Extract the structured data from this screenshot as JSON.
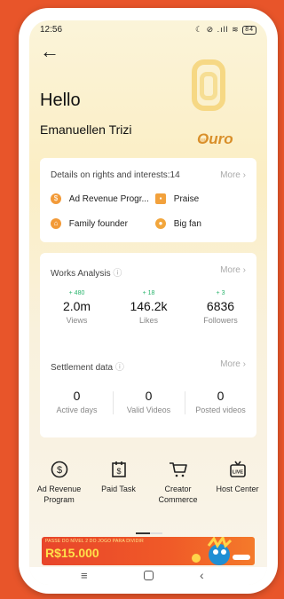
{
  "status_bar": {
    "time": "12:56",
    "icons": "☾ ⊘ .ıll ≋",
    "battery": "84"
  },
  "header": {
    "greeting": "Hello",
    "user_name": "Emanuellen Trizi",
    "level_roman": "III",
    "level_name": "Ouro"
  },
  "rights": {
    "title": "Details on rights and interests:14",
    "more": "More",
    "items": [
      {
        "label": "Ad Revenue Progr...",
        "icon": "dollar-coin-icon",
        "color": "#f29a38"
      },
      {
        "label": "Praise",
        "icon": "gift-icon",
        "color": "#f2a13c"
      },
      {
        "label": "Family founder",
        "icon": "family-icon",
        "color": "#f29a38"
      },
      {
        "label": "Big fan",
        "icon": "fan-person-icon",
        "color": "#f2a63c"
      }
    ]
  },
  "works": {
    "title": "Works Analysis",
    "more": "More",
    "stats": [
      {
        "delta": "+ 480",
        "value": "2.0m",
        "label": "Views"
      },
      {
        "delta": "+ 18",
        "value": "146.2k",
        "label": "Likes"
      },
      {
        "delta": "+ 3",
        "value": "6836",
        "label": "Followers"
      }
    ]
  },
  "settlement": {
    "title": "Settlement data",
    "more": "More",
    "stats": [
      {
        "value": "0",
        "label": "Active days"
      },
      {
        "value": "0",
        "label": "Valid Videos"
      },
      {
        "value": "0",
        "label": "Posted videos"
      }
    ]
  },
  "shortcuts": [
    {
      "label_1": "Ad Revenue",
      "label_2": "Program",
      "icon": "dollar-circle-icon"
    },
    {
      "label_1": "Paid Task",
      "label_2": "",
      "icon": "dollar-calendar-icon"
    },
    {
      "label_1": "Creator",
      "label_2": "Commerce",
      "icon": "shopping-cart-icon"
    },
    {
      "label_1": "Host Center",
      "label_2": "",
      "icon": "live-tv-icon"
    }
  ],
  "banner": {
    "line1": "PASSE DO NÍVEL 2 DO JOGO PARA DIVIDIR",
    "line2": "R$15.000"
  },
  "colors": {
    "accent_gold": "#d98f2a",
    "delta_green": "#27b36b",
    "background": "#e8552a"
  }
}
